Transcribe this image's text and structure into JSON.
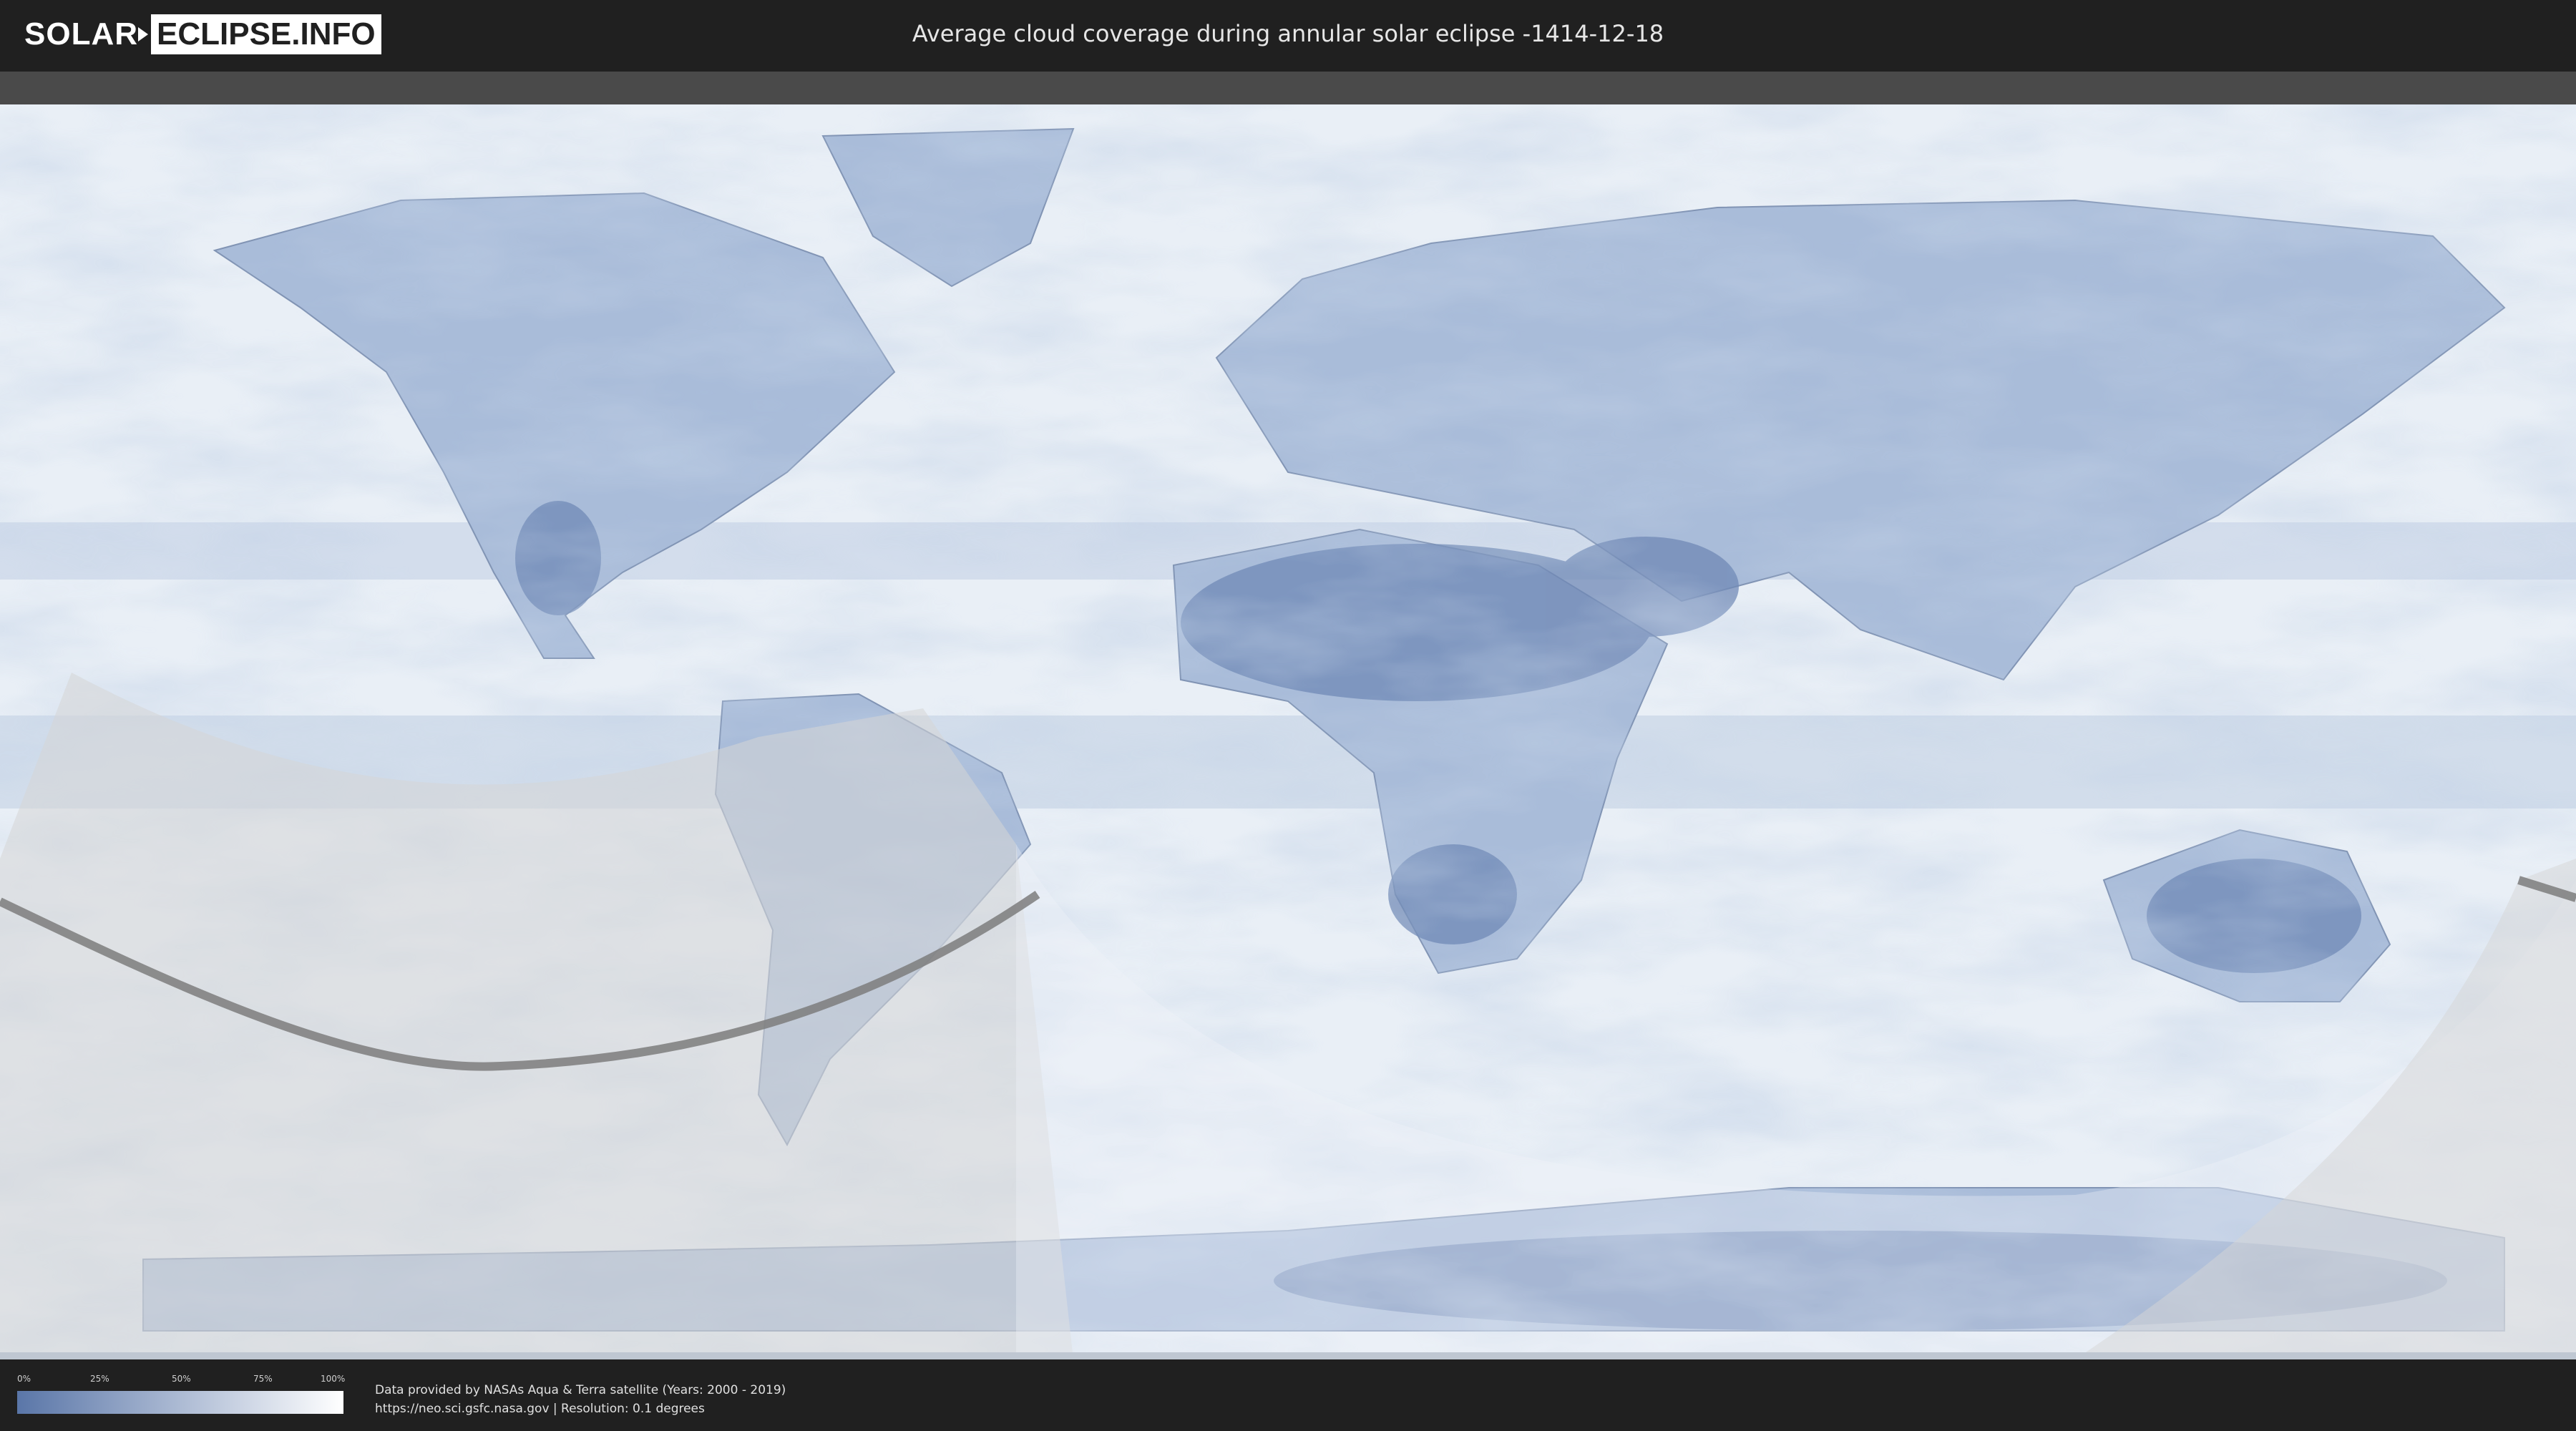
{
  "header": {
    "logo_left": "SOLAR",
    "logo_right": "ECLIPSE.INFO",
    "title": "Average cloud coverage during annular solar eclipse -1414-12-18"
  },
  "map": {
    "ocean_color": "#e9eff6",
    "land_color": "#9fb5d4",
    "dark_land_color": "#6f89b6",
    "shadow_color": "#d8d8d8",
    "path_color": "#7d7d7d"
  },
  "legend": {
    "ticks": [
      "0%",
      "25%",
      "50%",
      "75%",
      "100%"
    ],
    "gradient_start": "#5a76a8",
    "gradient_end": "#ffffff"
  },
  "footer": {
    "line1": "Data provided by NASAs Aqua & Terra satellite (Years: 2000 - 2019)",
    "line2": "https://neo.sci.gsfc.nasa.gov | Resolution: 0.1 degrees"
  }
}
